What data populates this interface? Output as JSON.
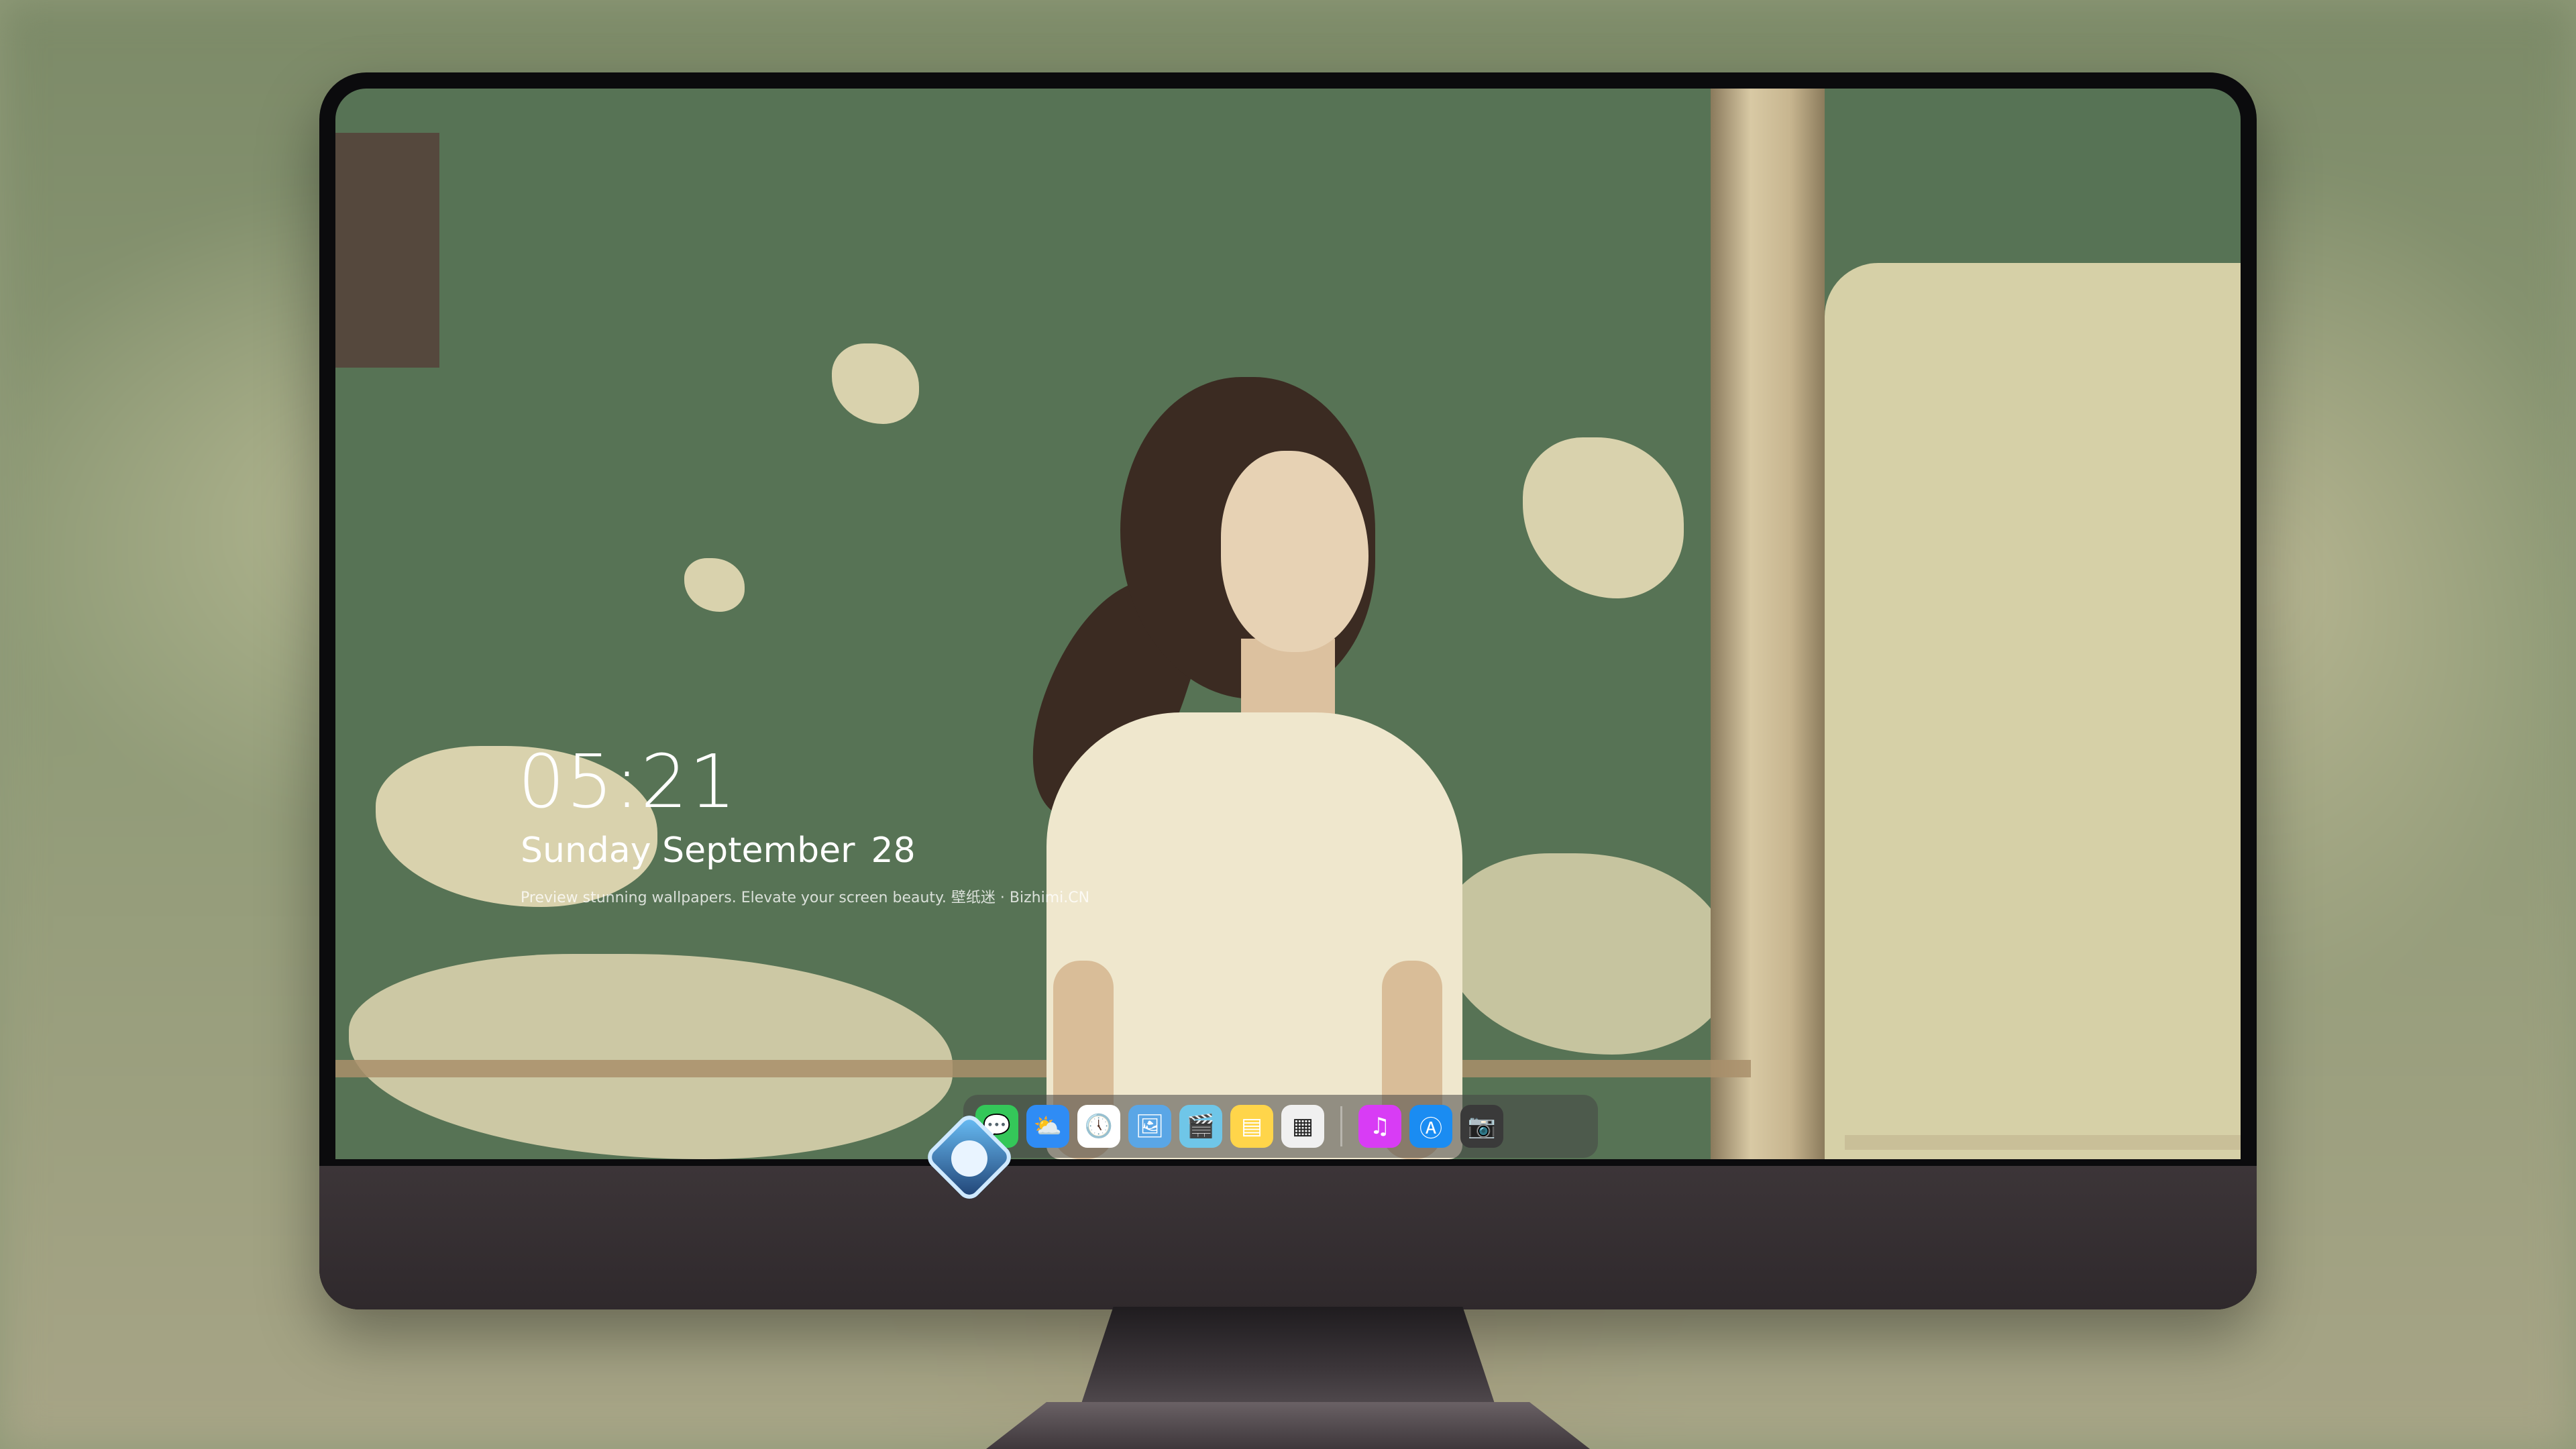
{
  "lockscreen": {
    "time": "05:21",
    "weekday_month": "Sunday September",
    "day": "28",
    "tagline": "Preview stunning wallpapers. Elevate your screen beauty. 壁纸迷 · Bizhimi.CN"
  },
  "dock": {
    "items": [
      {
        "name": "messages-icon",
        "glyph": "💬",
        "color": "#34c759"
      },
      {
        "name": "weather-icon",
        "glyph": "⛅",
        "color": "#2f8cf5"
      },
      {
        "name": "clock-icon",
        "glyph": "🕔",
        "color": "#ffffff"
      },
      {
        "name": "preview-icon",
        "glyph": "🖼",
        "color": "#5aa6e6"
      },
      {
        "name": "video-clapper-icon",
        "glyph": "🎬",
        "color": "#6fc6e8"
      },
      {
        "name": "notes-icon",
        "glyph": "▤",
        "color": "#ffd54a"
      },
      {
        "name": "photo-gallery-icon",
        "glyph": "▦",
        "color": "#f0f0f0"
      },
      {
        "name": "music-icon",
        "glyph": "♫",
        "color": "#d83cf5"
      },
      {
        "name": "app-store-icon",
        "glyph": "Ⓐ",
        "color": "#1a8cf2"
      },
      {
        "name": "camera-icon",
        "glyph": "📷",
        "color": "#3a3a3a"
      }
    ]
  },
  "colors": {
    "wallpaper_green": "#577355",
    "wall_cream": "#d9d2ad",
    "bezel": "#0b0b0d",
    "chin": "#3c3538"
  }
}
